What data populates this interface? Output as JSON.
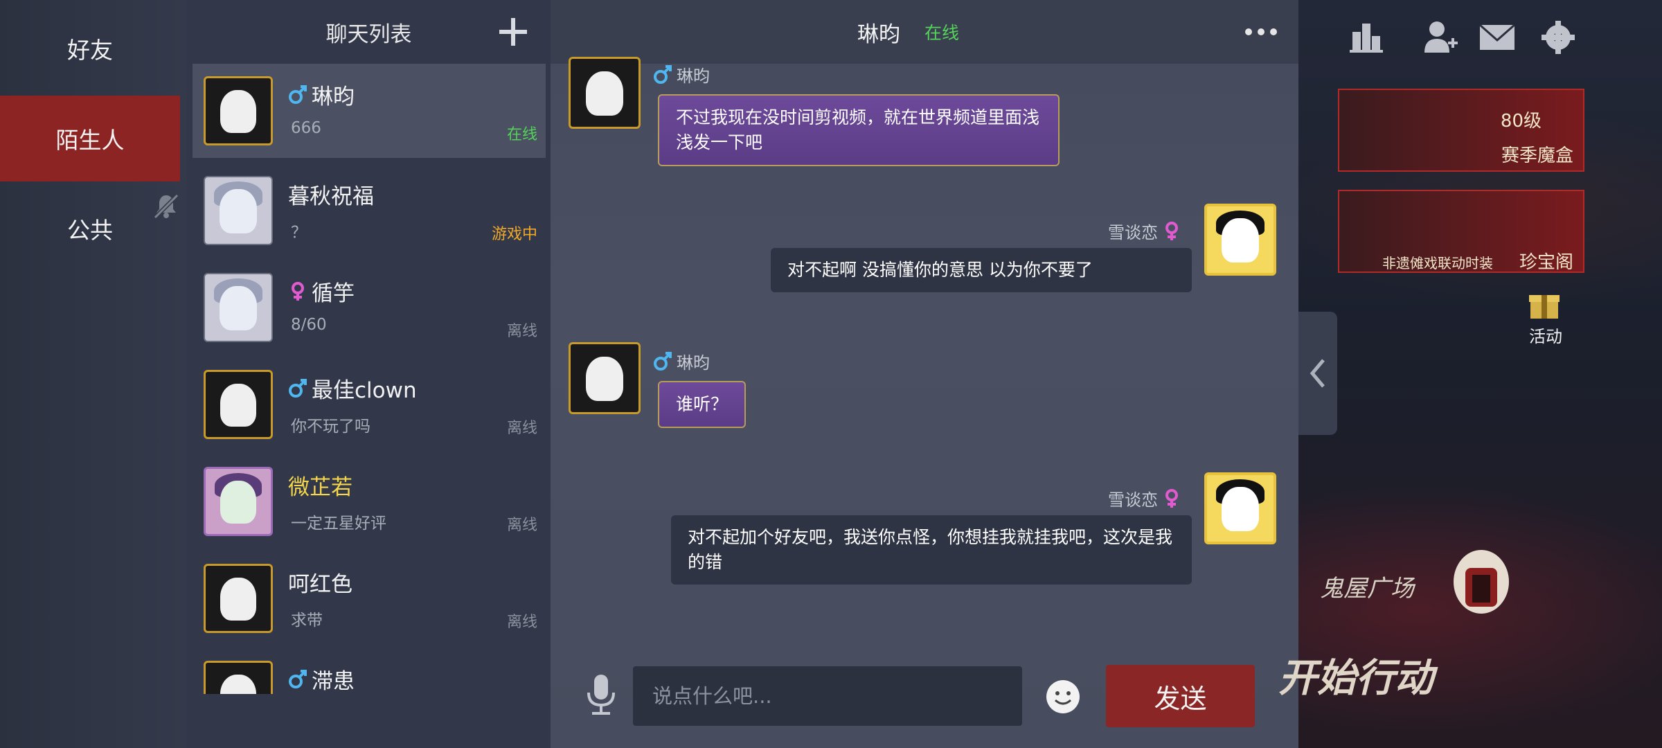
{
  "categories": [
    {
      "label": "好友",
      "active": false
    },
    {
      "label": "陌生人",
      "active": true
    },
    {
      "label": "公共",
      "active": false
    }
  ],
  "chat_list": {
    "title": "聊天列表",
    "items": [
      {
        "name": "琳昀",
        "gender": "male",
        "preview": "666",
        "status": "在线",
        "status_type": "online",
        "active": true,
        "avatar_style": "gold"
      },
      {
        "name": "暮秋祝福",
        "gender": "",
        "preview": "？",
        "status": "游戏中",
        "status_type": "game",
        "active": false,
        "avatar_style": "plain"
      },
      {
        "name": "循竽",
        "gender": "female",
        "preview": "8/60",
        "status": "离线",
        "status_type": "offline",
        "active": false,
        "avatar_style": "plain"
      },
      {
        "name": "最佳clown",
        "gender": "male",
        "preview": "你不玩了吗",
        "status": "离线",
        "status_type": "offline",
        "active": false,
        "avatar_style": "gold"
      },
      {
        "name": "微芷若",
        "gender": "",
        "preview": "一定五星好评",
        "status": "离线",
        "status_type": "offline",
        "active": false,
        "avatar_style": "vip"
      },
      {
        "name": "呵红色",
        "gender": "",
        "preview": "求带",
        "status": "离线",
        "status_type": "offline",
        "active": false,
        "avatar_style": "gold"
      },
      {
        "name": "滞患",
        "gender": "male",
        "preview": "",
        "status": "",
        "status_type": "offline",
        "active": false,
        "avatar_style": "gold"
      }
    ]
  },
  "chat": {
    "contact_name": "琳昀",
    "contact_status": "在线",
    "messages": [
      {
        "side": "left",
        "sender": "琳昀",
        "gender": "male",
        "text": "不过我现在没时间剪视频，就在世界频道里面浅浅发一下吧"
      },
      {
        "side": "right",
        "sender": "雪谈恋",
        "gender": "female",
        "text": "对不起啊 没搞懂你的意思 以为你不要了"
      },
      {
        "side": "left",
        "sender": "琳昀",
        "gender": "male",
        "text": "谁听？"
      },
      {
        "side": "right",
        "sender": "雪谈恋",
        "gender": "female",
        "text": "对不起加个好友吧，我送你点怪，你想挂我就挂我吧，这次是我的错"
      }
    ],
    "input_placeholder": "说点什么吧...",
    "send_label": "发送"
  },
  "game_overlay": {
    "season_box_level": "80级",
    "season_box_label": "赛季魔盒",
    "collab_label": "非遗傩戏联动时装",
    "treasure_label": "珍宝阁",
    "activity_label": "活动",
    "plaza_label": "鬼屋广场",
    "start_label": "开始行动"
  },
  "colors": {
    "active_category": "#8d2424",
    "online": "#55d25a",
    "in_game": "#f0a829",
    "offline": "#8b909c",
    "male": "#4fb6f0",
    "female": "#e05ad0",
    "send_button": "#8a2626",
    "left_bubble": "#6d4a9a"
  }
}
